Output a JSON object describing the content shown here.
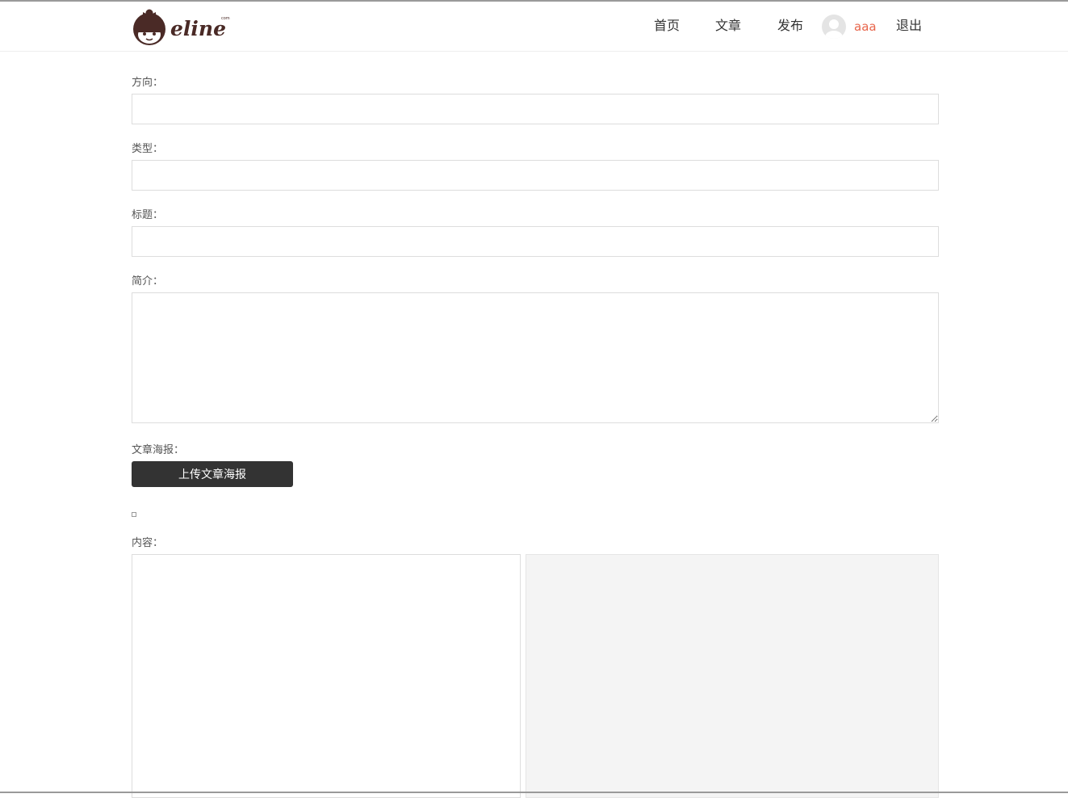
{
  "header": {
    "logo_text": "eline",
    "logo_sup": "com",
    "nav": {
      "home": "首页",
      "articles": "文章",
      "publish": "发布"
    },
    "username": "aaa",
    "logout": "退出"
  },
  "form": {
    "direction_label": "方向：",
    "direction_value": "",
    "type_label": "类型：",
    "type_value": "",
    "title_label": "标题：",
    "title_value": "",
    "summary_label": "简介：",
    "summary_value": "",
    "poster_label": "文章海报：",
    "upload_button": "上传文章海报",
    "content_label": "内容：",
    "content_value": ""
  },
  "colors": {
    "accent_username": "#e8664c",
    "button_bg": "#333333",
    "preview_bg": "#f4f4f4"
  }
}
